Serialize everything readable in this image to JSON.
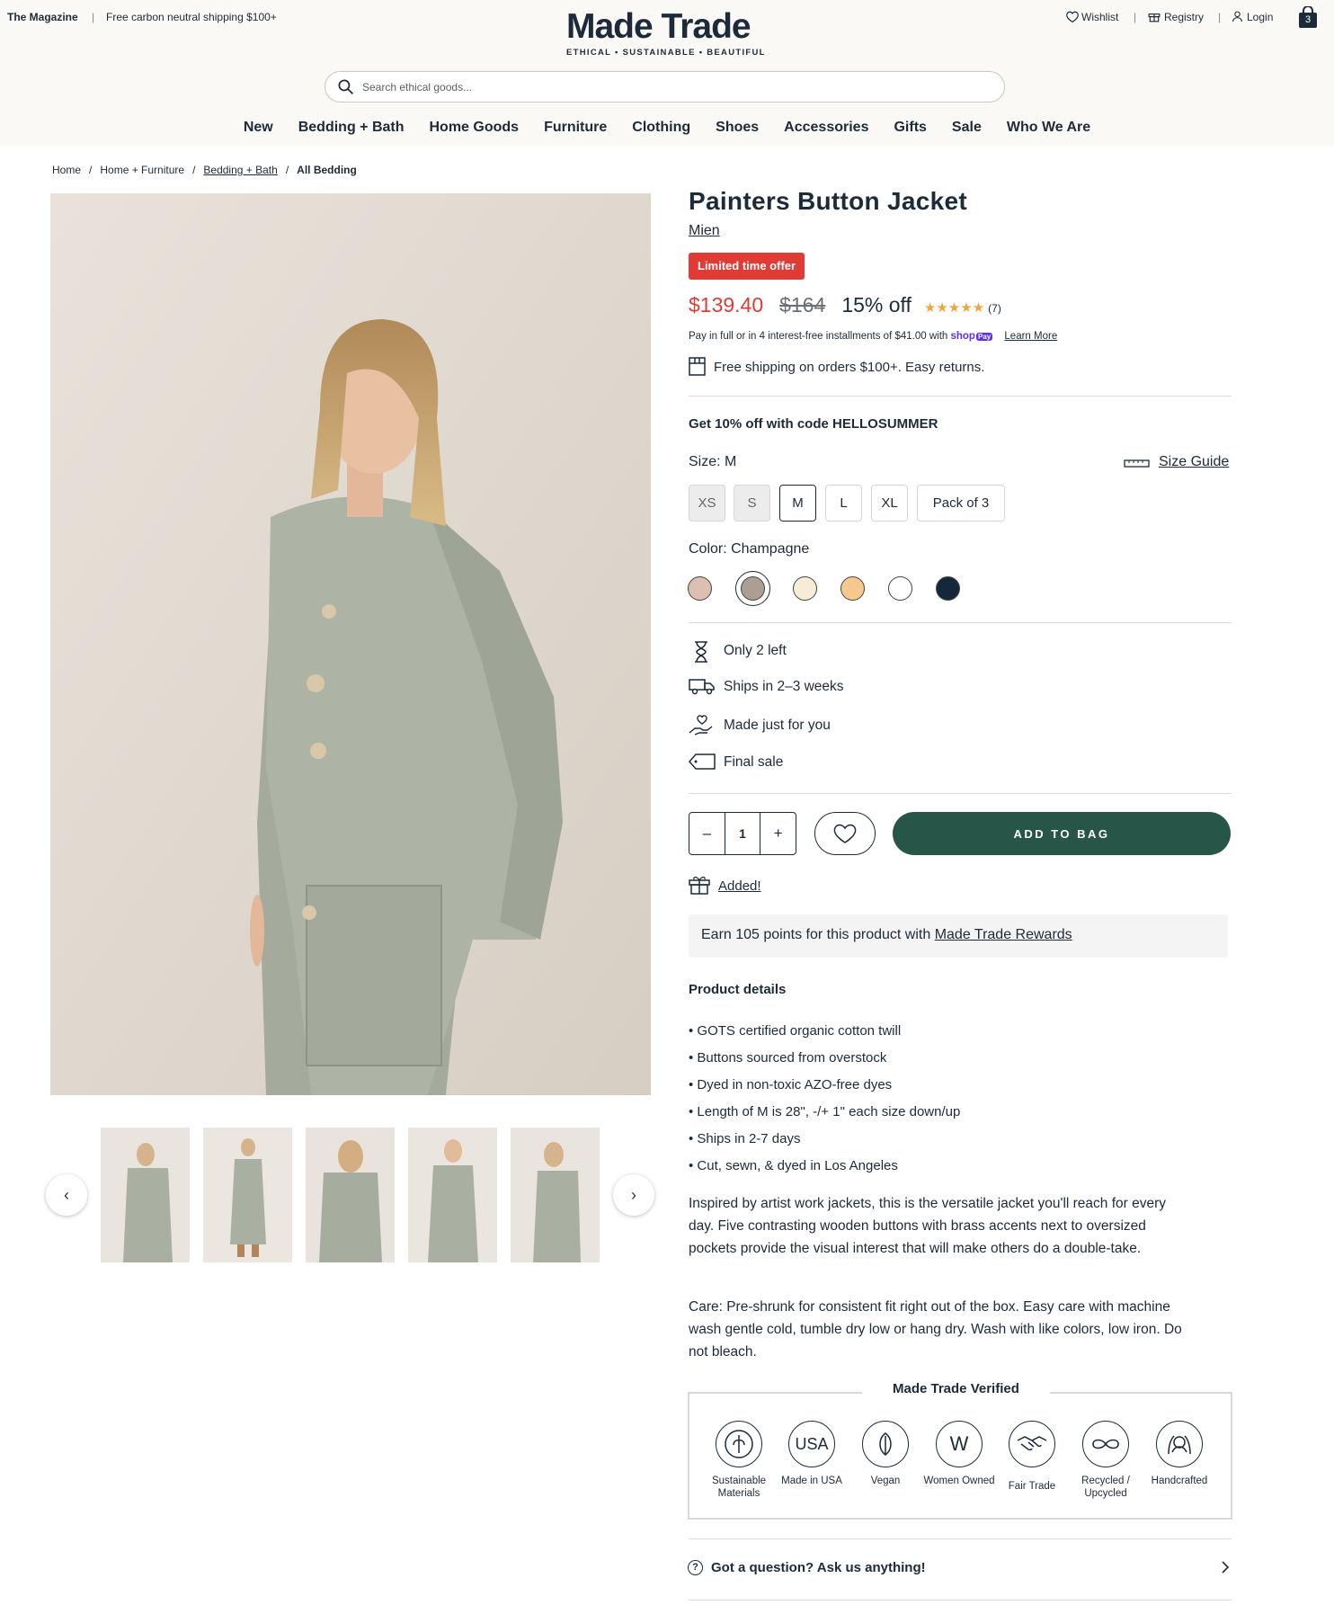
{
  "topbar": {
    "magazine": "The Magazine",
    "separator": "|",
    "shipping_promo": "Free carbon neutral shipping $100+",
    "wishlist": "Wishlist",
    "registry": "Registry",
    "login": "Login",
    "cart_count": "3"
  },
  "logo": {
    "name": "Made Trade",
    "tagline": "ETHICAL • SUSTAINABLE • BEAUTIFUL"
  },
  "search": {
    "placeholder": "Search ethical goods..."
  },
  "nav": [
    "New",
    "Bedding + Bath",
    "Home Goods",
    "Furniture",
    "Clothing",
    "Shoes",
    "Accessories",
    "Gifts",
    "Sale",
    "Who We Are"
  ],
  "breadcrumb": [
    "Home",
    "Home + Furniture",
    "Bedding + Bath",
    "All Bedding"
  ],
  "breadcrumb_sep": "/",
  "product": {
    "title": "Painters Button Jacket",
    "brand": "Mien",
    "badge": "Limited time offer",
    "price": "$139.40",
    "old_price": "$164",
    "discount": "15% off",
    "rating_stars": "★★★★★",
    "reviews": "(7)",
    "installments_text": "Pay in full or in 4 interest-free installments of $41.00 with",
    "shoppay": "shop",
    "shoppay_pill": "Pay",
    "learn_more": "Learn More",
    "shipping": "Free shipping on orders $100+. Easy returns.",
    "promo_code": "Get 10% off with code HELLOSUMMER",
    "size_label": "Size: M",
    "size_guide": "Size Guide",
    "sizes": [
      "XS",
      "S",
      "M",
      "L",
      "XL",
      "Pack of 3"
    ],
    "color_label": "Color: Champagne",
    "colors": [
      "#dcbfb1",
      "#aa9f92",
      "#f6ecd8",
      "#f6c890",
      "#ffffff",
      "#15283a"
    ],
    "features": [
      "Only 2 left",
      "Ships in 2–3 weeks",
      "Made just for you",
      "Final sale"
    ],
    "quantity": "1",
    "qty_minus": "–",
    "qty_plus": "+",
    "add_to_bag": "ADD TO BAG",
    "added": "Added!",
    "rewards_text": "Earn 105 points for this product with",
    "rewards_link": "Made Trade Rewards",
    "details_title": "Product details",
    "details": [
      "• GOTS certified organic cotton twill",
      "• Buttons sourced from overstock",
      "• Dyed in non-toxic AZO-free dyes",
      "• Length of M is 28\", -/+ 1\" each size down/up",
      "• Ships in 2-7 days",
      "• Cut, sewn, & dyed in Los Angeles"
    ],
    "description": "Inspired by artist work jackets, this is the versatile jacket you'll reach for every day. Five contrasting wooden buttons with brass accents next to oversized pockets provide the visual interest that will make others do a double-take.",
    "care": "Care: Pre-shrunk for consistent fit right out of the box. Easy care with machine wash gentle cold, tumble dry low or hang dry. Wash with like colors, low iron. Do not bleach."
  },
  "verified": {
    "title": "Made Trade Verified",
    "usa_text": "USA",
    "w_text": "W",
    "items": [
      "Sustainable Materials",
      "Made in USA",
      "Vegan",
      "Women Owned",
      "Fair Trade",
      "Recycled / Upcycled",
      "Handcrafted"
    ]
  },
  "question": "Got a question? Ask us anything!",
  "question_mark": "?",
  "carousel": {
    "prev": "‹",
    "next": "›"
  }
}
